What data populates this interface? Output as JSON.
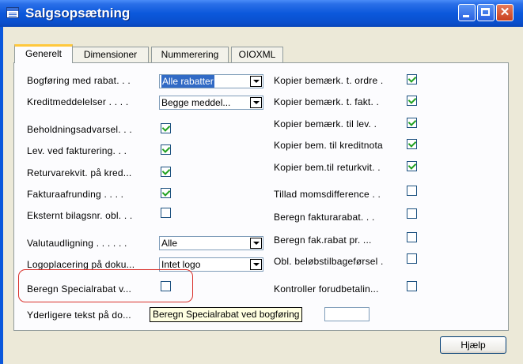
{
  "window": {
    "title": "Salgsopsætning"
  },
  "tabs": [
    {
      "label": "Generelt",
      "active": true
    },
    {
      "label": "Dimensioner",
      "active": false
    },
    {
      "label": "Nummerering",
      "active": false
    },
    {
      "label": "OIOXML",
      "active": false
    }
  ],
  "left": {
    "bogforing_label": "Bogføring med rabat. . .",
    "bogforing_value": "Alle rabatter",
    "kreditmeddelelser_label": "Kreditmeddelelser . . . .",
    "kreditmeddelelser_value": "Begge meddel...",
    "beholdning_label": "Beholdningsadvarsel. . .",
    "beholdning_checked": true,
    "lev_label": "Lev. ved fakturering. . .",
    "lev_checked": true,
    "returvare_label": "Returvarekvit. på kred...",
    "returvare_checked": true,
    "fakturaafrunding_label": "Fakturaafrunding . . . .",
    "fakturaafrunding_checked": true,
    "eksternt_label": "Eksternt bilagsnr. obl. . .",
    "eksternt_checked": false,
    "valuta_label": "Valutaudligning . . . . . .",
    "valuta_value": "Alle",
    "logo_label": "Logoplacering på doku...",
    "logo_value": "Intet logo",
    "special_label": "Beregn Specialrabat v...",
    "special_checked": false,
    "yderligere_label": "Yderligere tekst på do..."
  },
  "right": {
    "kop_ordre_label": "Kopier bemærk. t. ordre .",
    "kop_ordre_checked": true,
    "kop_fakt_label": "Kopier bemærk. t. fakt. .",
    "kop_fakt_checked": true,
    "kop_lev_label": "Kopier bemærk. til lev. .",
    "kop_lev_checked": true,
    "kop_kredit_label": "Kopier bem. til kreditnota",
    "kop_kredit_checked": true,
    "kop_retur_label": "Kopier bem.til returkvit. .",
    "kop_retur_checked": true,
    "moms_label": "Tillad momsdifference . .",
    "moms_checked": false,
    "fakturarabat_label": "Beregn fakturarabat. . .",
    "fakturarabat_checked": false,
    "fakrabat_label": "Beregn fak.rabat pr. ...",
    "fakrabat_checked": false,
    "belob_label": "Obl. beløbstilbageførsel .",
    "belob_checked": false,
    "forud_label": "Kontroller forudbetalin...",
    "forud_checked": false
  },
  "tooltip": "Beregn Specialrabat ved bogføring",
  "buttons": {
    "help": "Hjælp"
  },
  "colors": {
    "titlebar": "#0b58dc",
    "highlight": "#d9302a",
    "check": "#21a121",
    "tooltip_bg": "#ffffe1"
  }
}
